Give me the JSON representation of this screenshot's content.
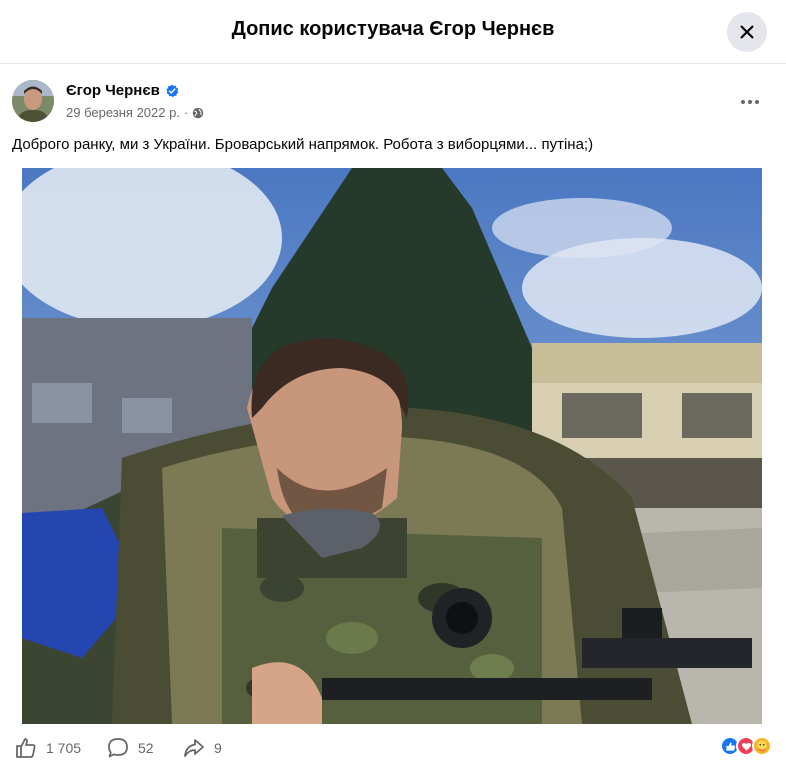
{
  "dialog": {
    "title": "Допис користувача Єгор Чернєв",
    "close_icon": "close-icon"
  },
  "post": {
    "author": "Єгор Чернєв",
    "verified_icon": "verified-badge-icon",
    "date": "29 березня 2022 р.",
    "separator": "·",
    "privacy_icon": "globe-icon",
    "more_icon": "more-horizontal-icon",
    "text": "Доброго ранку, ми з України. Броварський напрямок. Робота з виборцями... путіна;)",
    "photo_icon": "photo"
  },
  "stats": {
    "likes": "1 705",
    "comments": "52",
    "shares": "9",
    "like_icon": "thumbs-up-icon",
    "comment_icon": "comment-icon",
    "share_icon": "share-icon",
    "reaction_icons": [
      "like-reaction-icon",
      "love-reaction-icon",
      "care-reaction-icon"
    ]
  },
  "colors": {
    "like_blue": "#1877f2",
    "love_red": "#f33e58",
    "care_yellow": "#f7b125",
    "verified_blue": "#1877f2"
  }
}
